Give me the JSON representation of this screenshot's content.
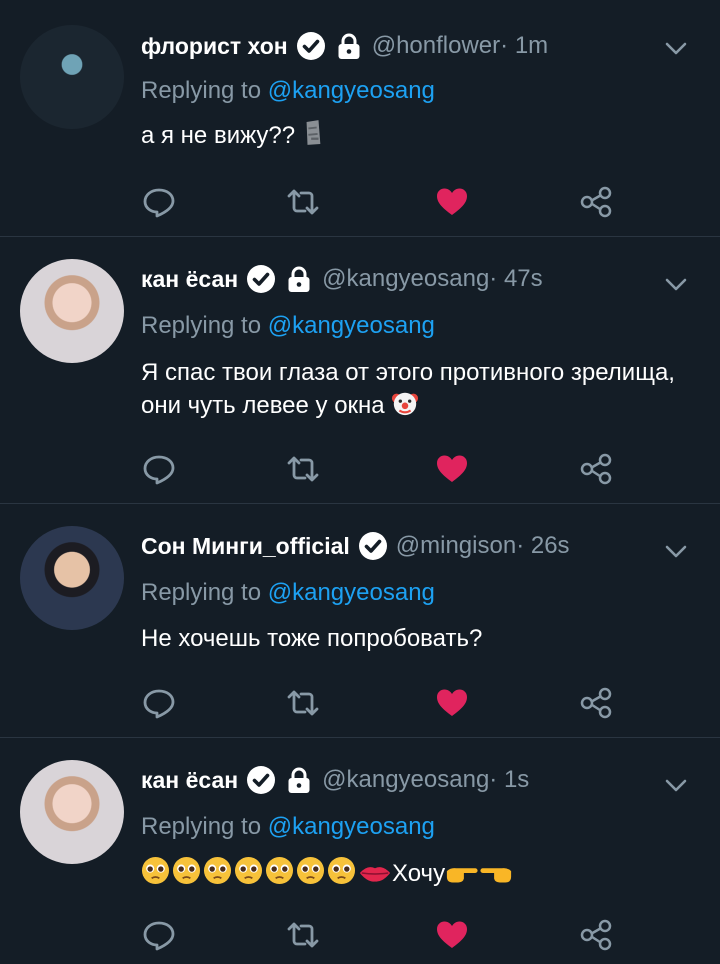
{
  "tweets": [
    {
      "name": "флорист хон",
      "handle": "@honflower",
      "time": " · 1m",
      "replying_prefix": "Replying to ",
      "replying_handle": "@kangyeosang",
      "text": "а я не вижу??",
      "avatar": "honflower-avatar",
      "emoji": [
        "moai"
      ]
    },
    {
      "name": "кан ёсан",
      "handle": "@kangyeosang",
      "time": " · 47s",
      "replying_prefix": "Replying to ",
      "replying_handle": "@kangyeosang",
      "text": "Я спас твои глаза от этого противного зрелища, они чуть левее у окна",
      "avatar": "kangyeosang-avatar",
      "emoji": [
        "clown"
      ]
    },
    {
      "name": "Сон Минги_official",
      "handle": "@mingison",
      "time": " · 26s",
      "replying_prefix": "Replying to ",
      "replying_handle": "@kangyeosang",
      "text": "Не хочешь тоже попробовать?",
      "avatar": "mingison-avatar",
      "emoji": []
    },
    {
      "name": "кан ёсан",
      "handle": "@kangyeosang",
      "time": " · 1s",
      "replying_prefix": "Replying to ",
      "replying_handle": "@kangyeosang",
      "text": "Хочу",
      "avatar": "kangyeosang-avatar",
      "emoji": [
        "pleading",
        "pleading",
        "pleading",
        "pleading",
        "pleading",
        "pleading",
        "pleading",
        "lips",
        "point-right",
        "point-left"
      ]
    }
  ],
  "icons": {
    "verified": "verified-badge-icon",
    "protected": "lock-icon",
    "menu": "chevron-down-icon",
    "reply": "reply-icon",
    "retweet": "retweet-icon",
    "like": "heart-icon",
    "share": "share-icon"
  },
  "colors": {
    "background": "#141d26",
    "muted_text": "#8899a6",
    "link": "#1da1f2",
    "like_active": "#e0245e",
    "divider": "#2a3541"
  }
}
